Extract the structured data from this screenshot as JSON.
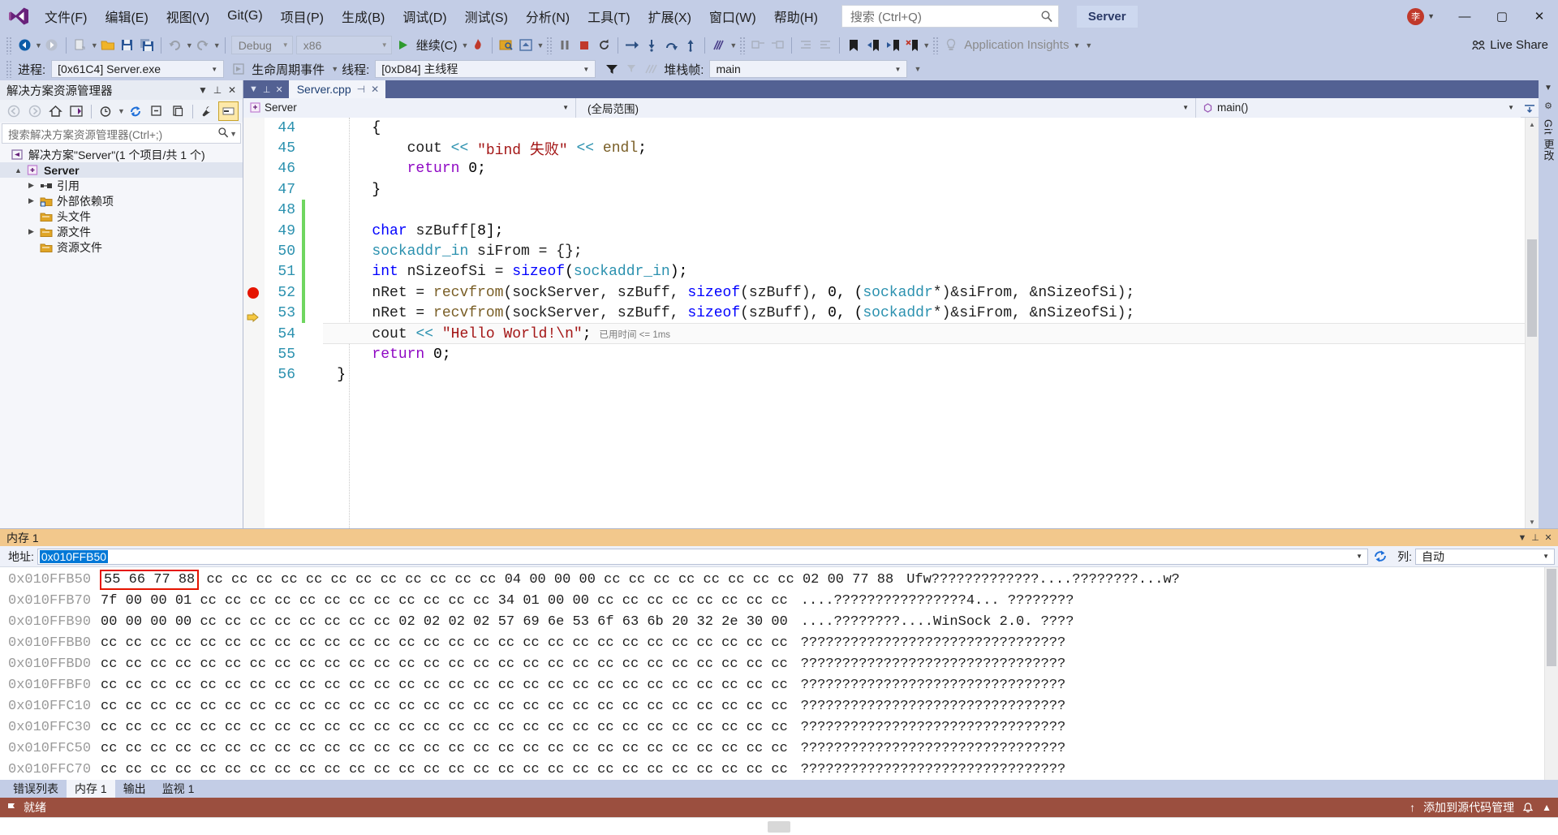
{
  "window": {
    "title_badge": "Server",
    "live_share": "Live Share",
    "user_initials": "李",
    "minimize": "—",
    "maximize": "▢",
    "close": "✕"
  },
  "menubar": {
    "items": [
      {
        "label": "文件(F)",
        "name": "menu-file"
      },
      {
        "label": "编辑(E)",
        "name": "menu-edit"
      },
      {
        "label": "视图(V)",
        "name": "menu-view"
      },
      {
        "label": "Git(G)",
        "name": "menu-git"
      },
      {
        "label": "项目(P)",
        "name": "menu-project"
      },
      {
        "label": "生成(B)",
        "name": "menu-build"
      },
      {
        "label": "调试(D)",
        "name": "menu-debug"
      },
      {
        "label": "测试(S)",
        "name": "menu-test"
      },
      {
        "label": "分析(N)",
        "name": "menu-analyze"
      },
      {
        "label": "工具(T)",
        "name": "menu-tools"
      },
      {
        "label": "扩展(X)",
        "name": "menu-extensions"
      },
      {
        "label": "窗口(W)",
        "name": "menu-window"
      },
      {
        "label": "帮助(H)",
        "name": "menu-help"
      }
    ],
    "search_placeholder": "搜索 (Ctrl+Q)"
  },
  "toolbar": {
    "config": "Debug",
    "platform": "x86",
    "continue_label": "继续(C)",
    "app_insights": "Application Insights"
  },
  "debugbar": {
    "process_label": "进程:",
    "process_value": "[0x61C4] Server.exe",
    "lifecycle_label": "生命周期事件",
    "thread_label": "线程:",
    "thread_value": "[0xD84] 主线程",
    "stackframe_label": "堆栈帧:",
    "stackframe_value": "main"
  },
  "solution_explorer": {
    "title": "解决方案资源管理器",
    "search_placeholder": "搜索解决方案资源管理器(Ctrl+;)",
    "tree": [
      {
        "label": "解决方案\"Server\"(1 个项目/共 1 个)",
        "indent": 0,
        "arrow": "",
        "icon": "solution-icon",
        "bold": false,
        "name": "tree-item-solution"
      },
      {
        "label": "Server",
        "indent": 1,
        "arrow": "▲",
        "icon": "project-icon",
        "bold": true,
        "name": "tree-item-project-server"
      },
      {
        "label": "引用",
        "indent": 2,
        "arrow": "▶",
        "icon": "references-icon",
        "bold": false,
        "name": "tree-item-references"
      },
      {
        "label": "外部依赖项",
        "indent": 2,
        "arrow": "▶",
        "icon": "external-deps-icon",
        "bold": false,
        "name": "tree-item-external-dependencies"
      },
      {
        "label": "头文件",
        "indent": 2,
        "arrow": "",
        "icon": "folder-icon",
        "bold": false,
        "name": "tree-item-header-files"
      },
      {
        "label": "源文件",
        "indent": 2,
        "arrow": "▶",
        "icon": "folder-icon",
        "bold": false,
        "name": "tree-item-source-files"
      },
      {
        "label": "资源文件",
        "indent": 2,
        "arrow": "",
        "icon": "folder-icon",
        "bold": false,
        "name": "tree-item-resource-files"
      }
    ]
  },
  "editor": {
    "tab_label": "Server.cpp",
    "nav_project": "Server",
    "nav_scope": "(全局范围)",
    "nav_member": "main()",
    "timing_tooltip": "已用时间 <= 1ms",
    "lines": [
      {
        "num": "44",
        "indent": 1,
        "changed": false,
        "tokens": [
          {
            "t": "{",
            "c": "k-op"
          }
        ]
      },
      {
        "num": "45",
        "indent": 2,
        "changed": false,
        "tokens": [
          {
            "t": "cout ",
            "c": "k-id"
          },
          {
            "t": "<<",
            "c": "k-type"
          },
          {
            "t": " ",
            "c": "k-id"
          },
          {
            "t": "\"bind 失败\"",
            "c": "k-str"
          },
          {
            "t": " ",
            "c": "k-id"
          },
          {
            "t": "<<",
            "c": "k-type"
          },
          {
            "t": " ",
            "c": "k-id"
          },
          {
            "t": "endl",
            "c": "k-fn"
          },
          {
            "t": ";",
            "c": "k-op"
          }
        ]
      },
      {
        "num": "46",
        "indent": 2,
        "changed": false,
        "tokens": [
          {
            "t": "return",
            "c": "k-kw"
          },
          {
            "t": " ",
            "c": "k-id"
          },
          {
            "t": "0",
            "c": "k-num"
          },
          {
            "t": ";",
            "c": "k-op"
          }
        ]
      },
      {
        "num": "47",
        "indent": 1,
        "changed": false,
        "tokens": [
          {
            "t": "}",
            "c": "k-op"
          }
        ]
      },
      {
        "num": "48",
        "indent": 1,
        "changed": true,
        "tokens": []
      },
      {
        "num": "49",
        "indent": 1,
        "changed": true,
        "tokens": [
          {
            "t": "char",
            "c": "k-blue"
          },
          {
            "t": " szBuff[",
            "c": "k-id"
          },
          {
            "t": "8",
            "c": "k-num"
          },
          {
            "t": "];",
            "c": "k-op"
          }
        ]
      },
      {
        "num": "50",
        "indent": 1,
        "changed": true,
        "tokens": [
          {
            "t": "sockaddr_in",
            "c": "k-type"
          },
          {
            "t": " siFrom = {};",
            "c": "k-id"
          }
        ]
      },
      {
        "num": "51",
        "indent": 1,
        "changed": true,
        "tokens": [
          {
            "t": "int",
            "c": "k-blue"
          },
          {
            "t": " nSizeofSi = ",
            "c": "k-id"
          },
          {
            "t": "sizeof",
            "c": "k-blue"
          },
          {
            "t": "(",
            "c": "k-op"
          },
          {
            "t": "sockaddr_in",
            "c": "k-type"
          },
          {
            "t": ");",
            "c": "k-op"
          }
        ]
      },
      {
        "num": "52",
        "indent": 1,
        "changed": true,
        "tokens": [
          {
            "t": "nRet = ",
            "c": "k-id"
          },
          {
            "t": "recvfrom",
            "c": "k-fn"
          },
          {
            "t": "(sockServer, szBuff, ",
            "c": "k-id"
          },
          {
            "t": "sizeof",
            "c": "k-blue"
          },
          {
            "t": "(szBuff), ",
            "c": "k-id"
          },
          {
            "t": "0",
            "c": "k-num"
          },
          {
            "t": ", (",
            "c": "k-op"
          },
          {
            "t": "sockaddr",
            "c": "k-type"
          },
          {
            "t": "*)&siFrom, &nSizeofSi);",
            "c": "k-id"
          }
        ]
      },
      {
        "num": "53",
        "indent": 1,
        "changed": true,
        "tokens": [
          {
            "t": "nRet = ",
            "c": "k-id"
          },
          {
            "t": "recvfrom",
            "c": "k-fn"
          },
          {
            "t": "(sockServer, szBuff, ",
            "c": "k-id"
          },
          {
            "t": "sizeof",
            "c": "k-blue"
          },
          {
            "t": "(szBuff), ",
            "c": "k-id"
          },
          {
            "t": "0",
            "c": "k-num"
          },
          {
            "t": ", (",
            "c": "k-op"
          },
          {
            "t": "sockaddr",
            "c": "k-type"
          },
          {
            "t": "*)&siFrom, &nSizeofSi);",
            "c": "k-id"
          }
        ]
      },
      {
        "num": "54",
        "indent": 1,
        "changed": false,
        "tokens": [
          {
            "t": "cout ",
            "c": "k-id"
          },
          {
            "t": "<<",
            "c": "k-type"
          },
          {
            "t": " ",
            "c": "k-id"
          },
          {
            "t": "\"Hello World!\\n\"",
            "c": "k-str"
          },
          {
            "t": ";",
            "c": "k-op"
          }
        ]
      },
      {
        "num": "55",
        "indent": 1,
        "changed": false,
        "tokens": [
          {
            "t": "return",
            "c": "k-kw"
          },
          {
            "t": " ",
            "c": "k-id"
          },
          {
            "t": "0",
            "c": "k-num"
          },
          {
            "t": ";",
            "c": "k-op"
          }
        ]
      },
      {
        "num": "56",
        "indent": 0,
        "changed": false,
        "tokens": [
          {
            "t": "}",
            "c": "k-op"
          }
        ]
      }
    ],
    "breakpoint_line": "53",
    "current_line": "54",
    "right_dock_git": "Git 更改"
  },
  "memory": {
    "title": "内存 1",
    "address_label": "地址:",
    "address_value": "0x010FFB50",
    "columns_label": "列:",
    "columns_value": "自动",
    "highlight_bytes": "55 66 77 88",
    "rows": [
      {
        "addr": "0x010FFB50",
        "hl": "55 66 77 88",
        "hex": "cc cc cc cc cc cc cc cc cc cc cc cc 04 00 00 00 cc cc cc cc cc cc cc cc 02 00 77 88",
        "ascii": "Ufw?????????????....????????...w?"
      },
      {
        "addr": "0x010FFB70",
        "hl": "",
        "hex": "7f 00 00 01 cc cc cc cc cc cc cc cc cc cc cc cc 34 01 00 00 cc cc cc cc cc cc cc cc",
        "ascii": "....????????????????4... ????????"
      },
      {
        "addr": "0x010FFB90",
        "hl": "",
        "hex": "00 00 00 00 cc cc cc cc cc cc cc cc 02 02 02 02 57 69 6e 53 6f 63 6b 20 32 2e 30 00",
        "ascii": "....????????....WinSock 2.0. ????"
      },
      {
        "addr": "0x010FFBB0",
        "hl": "",
        "hex": "cc cc cc cc cc cc cc cc cc cc cc cc cc cc cc cc cc cc cc cc cc cc cc cc cc cc cc cc",
        "ascii": "????????????????????????????????"
      },
      {
        "addr": "0x010FFBD0",
        "hl": "",
        "hex": "cc cc cc cc cc cc cc cc cc cc cc cc cc cc cc cc cc cc cc cc cc cc cc cc cc cc cc cc",
        "ascii": "????????????????????????????????"
      },
      {
        "addr": "0x010FFBF0",
        "hl": "",
        "hex": "cc cc cc cc cc cc cc cc cc cc cc cc cc cc cc cc cc cc cc cc cc cc cc cc cc cc cc cc",
        "ascii": "????????????????????????????????"
      },
      {
        "addr": "0x010FFC10",
        "hl": "",
        "hex": "cc cc cc cc cc cc cc cc cc cc cc cc cc cc cc cc cc cc cc cc cc cc cc cc cc cc cc cc",
        "ascii": "????????????????????????????????"
      },
      {
        "addr": "0x010FFC30",
        "hl": "",
        "hex": "cc cc cc cc cc cc cc cc cc cc cc cc cc cc cc cc cc cc cc cc cc cc cc cc cc cc cc cc",
        "ascii": "????????????????????????????????"
      },
      {
        "addr": "0x010FFC50",
        "hl": "",
        "hex": "cc cc cc cc cc cc cc cc cc cc cc cc cc cc cc cc cc cc cc cc cc cc cc cc cc cc cc cc",
        "ascii": "????????????????????????????????"
      },
      {
        "addr": "0x010FFC70",
        "hl": "",
        "hex": "cc cc cc cc cc cc cc cc cc cc cc cc cc cc cc cc cc cc cc cc cc cc cc cc cc cc cc cc",
        "ascii": "????????????????????????????????"
      }
    ],
    "tabs": [
      {
        "label": "错误列表",
        "selected": false,
        "name": "bottom-tab-error-list"
      },
      {
        "label": "内存 1",
        "selected": true,
        "name": "bottom-tab-memory-1"
      },
      {
        "label": "输出",
        "selected": false,
        "name": "bottom-tab-output"
      },
      {
        "label": "监视 1",
        "selected": false,
        "name": "bottom-tab-watch-1"
      }
    ]
  },
  "statusbar": {
    "state": "就绪",
    "source_control": "添加到源代码管理",
    "up_arrow": "↑"
  }
}
